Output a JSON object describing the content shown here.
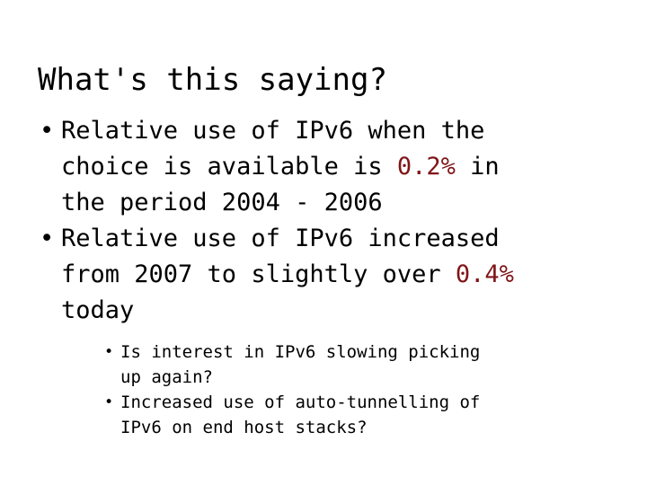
{
  "slide": {
    "title": "What's this saying?",
    "background_color": "#ffffff",
    "text_color": "#000000",
    "highlight_color": "#7f1518",
    "bullets": [
      {
        "marker": "•",
        "lines": [
          {
            "pre": "Relative use of IPv6 when the",
            "highlight": "",
            "post": ""
          },
          {
            "pre": "choice is available is ",
            "highlight": "0.2%",
            "post": " in"
          },
          {
            "pre": "the period 2004 - 2006",
            "highlight": "",
            "post": ""
          }
        ]
      },
      {
        "marker": "•",
        "lines": [
          {
            "pre": "Relative use of IPv6 increased",
            "highlight": "",
            "post": ""
          },
          {
            "pre": "from 2007 to slightly over ",
            "highlight": "0.4%",
            "post": ""
          },
          {
            "pre": "today",
            "highlight": "",
            "post": ""
          }
        ]
      }
    ],
    "sub_bullets": [
      {
        "marker": "•",
        "lines": [
          {
            "pre": "Is interest in IPv6 slowing picking",
            "highlight": "",
            "post": ""
          },
          {
            "pre": "up again?",
            "highlight": "",
            "post": ""
          }
        ]
      },
      {
        "marker": "•",
        "lines": [
          {
            "pre": "Increased use of auto-tunnelling of",
            "highlight": "",
            "post": ""
          },
          {
            "pre": "IPv6 on end host stacks?",
            "highlight": "",
            "post": ""
          }
        ]
      }
    ]
  }
}
